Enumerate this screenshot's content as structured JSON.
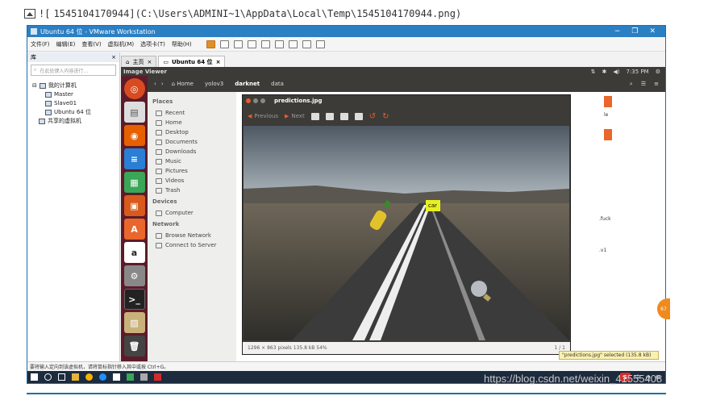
{
  "markdown": {
    "prefix": "![",
    "text": "1545104170944](C:\\Users\\ADMINI~1\\AppData\\Local\\Temp\\1545104170944.png)"
  },
  "vmware": {
    "title": "Ubuntu 64 位 - VMware Workstation",
    "menu": [
      "文件(F)",
      "编辑(E)",
      "查看(V)",
      "虚拟机(M)",
      "选项卡(T)",
      "帮助(H)"
    ],
    "library": {
      "title": "库",
      "close": "×",
      "search_placeholder": "在此处键入内容进行...",
      "tree": {
        "root": "我的计算机",
        "children": [
          "Master",
          "Slave01",
          "Ubuntu 64 位"
        ],
        "shared": "共享的虚拟机"
      }
    },
    "tabs": [
      {
        "label": "主页"
      },
      {
        "label": "Ubuntu 64 位"
      }
    ],
    "status_hint": "要将输入定向到该虚拟机，请将鼠标指针移入其中或按 Ctrl+G。"
  },
  "ubuntu": {
    "topbar_title": "Image Viewer",
    "clock": "7:35 PM",
    "breadcrumbs": [
      "Home",
      "yolov3",
      "darknet",
      "data"
    ],
    "places_heading": "Places",
    "places": [
      "Recent",
      "Home",
      "Desktop",
      "Documents",
      "Downloads",
      "Music",
      "Pictures",
      "Videos",
      "Trash"
    ],
    "devices_heading": "Devices",
    "devices": [
      "Computer"
    ],
    "network_heading": "Network",
    "network": [
      "Browse Network",
      "Connect to Server"
    ],
    "file_fragments": [
      ".fuck",
      ".v1",
      "le"
    ],
    "selected_status": "\"predictions.jpg\" selected (135.8 kB)"
  },
  "viewer": {
    "title": "predictions.jpg",
    "prev": "Previous",
    "next": "Next",
    "detection_label": "car",
    "status_info": "1296 × 863 pixels  135.8 kB   54%",
    "page_count": "1 / 1"
  },
  "watermark": "https://blog.csdn.net/weixin_41555408",
  "badge_text": "67"
}
